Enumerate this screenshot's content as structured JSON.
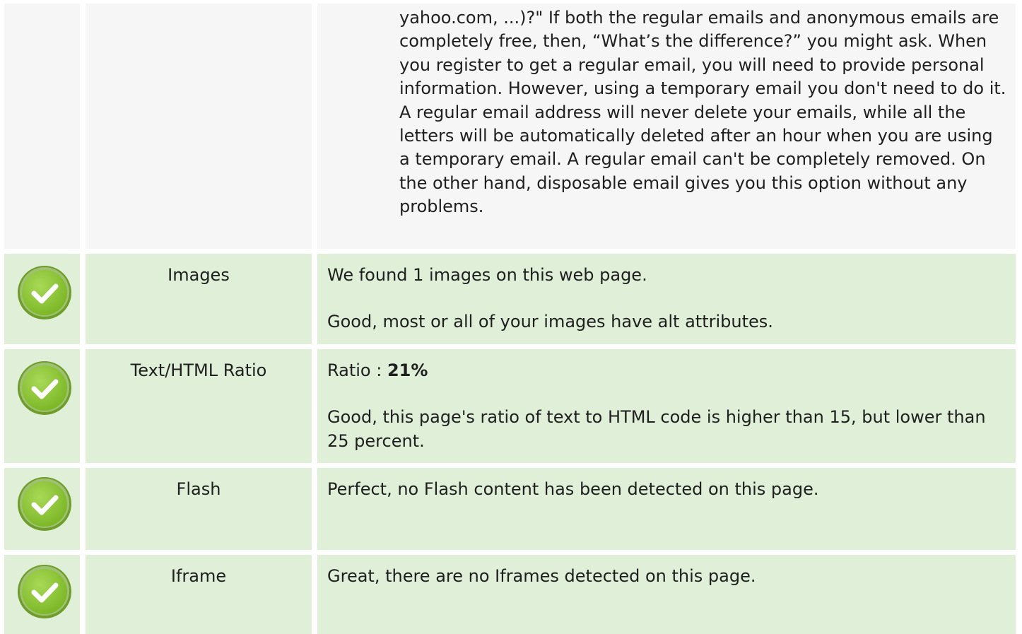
{
  "colors": {
    "good_bg": "#dfefd8",
    "neutral_bg": "#f6f6f6",
    "check_green": "#8cc63f"
  },
  "description": {
    "text": "yahoo.com, ...)?\" If both the regular emails and anonymous emails are completely free, then, “What’s the difference?” you might ask. When you register to get a regular email, you will need to provide personal information. However, using a temporary email you don't need to do it. A regular email address will never delete your emails, while all the letters will be automatically deleted after an hour when you are using a temporary email. A regular email can't be completely removed. On the other hand, disposable email gives you this option without any problems."
  },
  "rows": [
    {
      "status_icon": "check-icon",
      "label": "Images",
      "line1": "We found 1 images on this web page.",
      "line2": "Good, most or all of your images have alt attributes."
    },
    {
      "status_icon": "check-icon",
      "label": "Text/HTML Ratio",
      "ratio_prefix": "Ratio : ",
      "ratio_value": "21%",
      "line2": "Good, this page's ratio of text to HTML code is higher than 15, but lower than 25 percent."
    },
    {
      "status_icon": "check-icon",
      "label": "Flash",
      "line1": "Perfect, no Flash content has been detected on this page."
    },
    {
      "status_icon": "check-icon",
      "label": "Iframe",
      "line1": "Great, there are no Iframes detected on this page."
    }
  ]
}
